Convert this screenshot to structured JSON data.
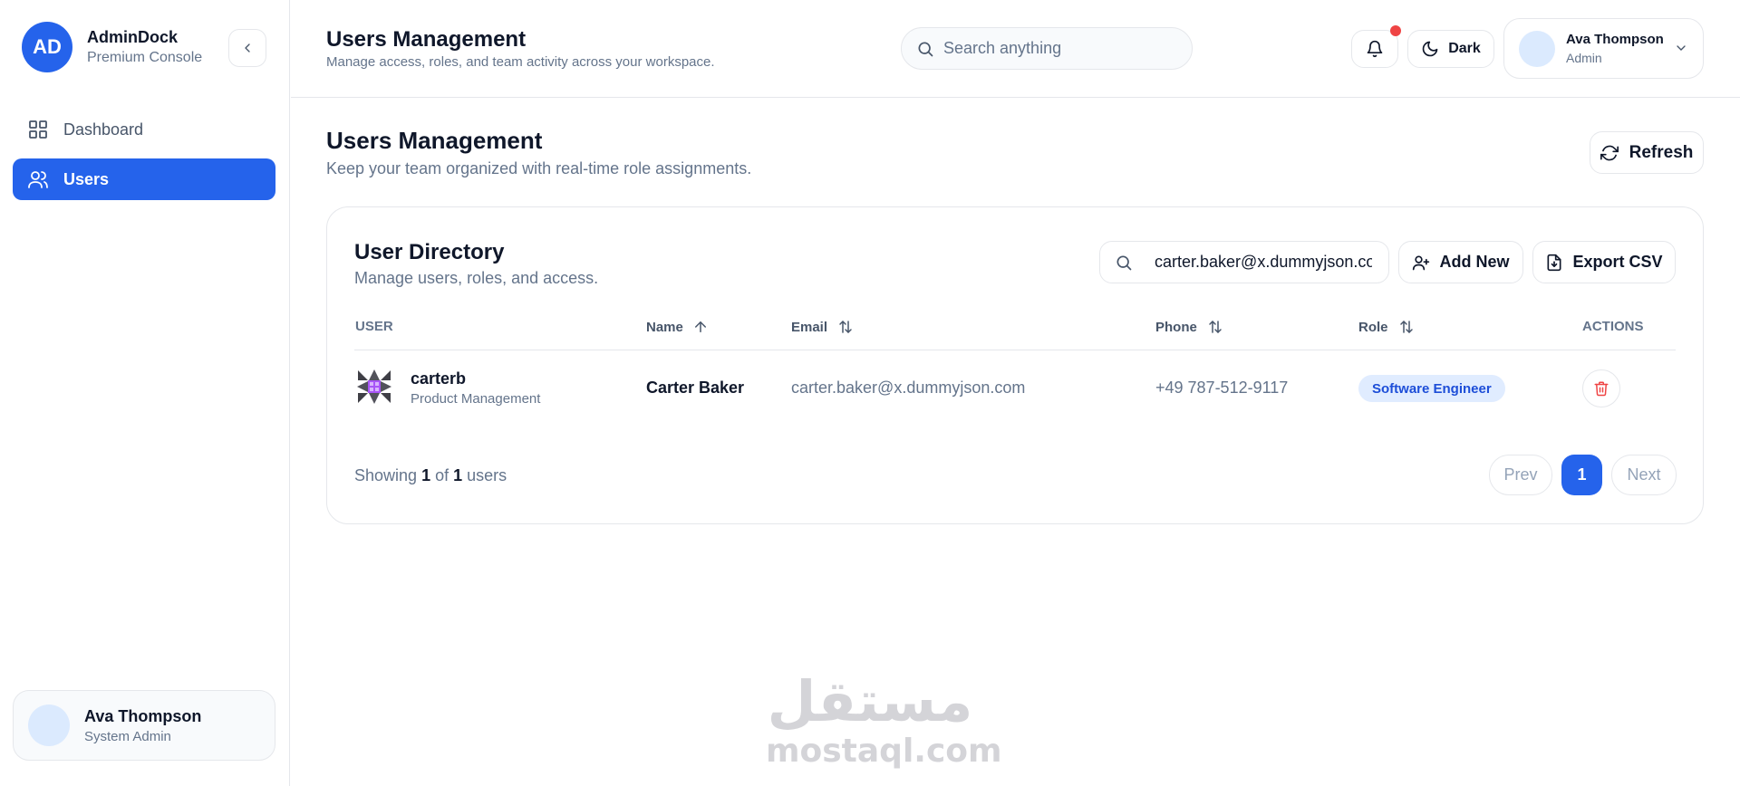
{
  "brand": {
    "logo_text": "AD",
    "name": "AdminDock",
    "subtitle": "Premium Console"
  },
  "sidebar": {
    "items": [
      {
        "label": "Dashboard",
        "icon": "dashboard-grid-icon",
        "active": false
      },
      {
        "label": "Users",
        "icon": "users-icon",
        "active": true
      }
    ],
    "profile": {
      "name": "Ava Thompson",
      "role": "System Admin"
    }
  },
  "header": {
    "title": "Users Management",
    "subtitle": "Manage access, roles, and team activity across your workspace.",
    "search_placeholder": "Search anything",
    "theme_label": "Dark",
    "user": {
      "name": "Ava Thompson",
      "role": "Admin"
    }
  },
  "page": {
    "title": "Users Management",
    "subtitle": "Keep your team organized with real-time role assignments.",
    "refresh_label": "Refresh"
  },
  "directory": {
    "title": "User Directory",
    "subtitle": "Manage users, roles, and access.",
    "search_value": "carter.baker@x.dummyjson.com",
    "add_label": "Add New",
    "export_label": "Export CSV",
    "columns": [
      "USER",
      "Name",
      "Email",
      "Phone",
      "Role",
      "ACTIONS"
    ],
    "rows": [
      {
        "username": "carterb",
        "department": "Product Management",
        "name": "Carter Baker",
        "email": "carter.baker@x.dummyjson.com",
        "phone": "+49 787-512-9117",
        "role": "Software Engineer"
      }
    ],
    "showing_prefix": "Showing",
    "showing_count": "1",
    "showing_of": "of",
    "showing_total": "1",
    "showing_suffix": "users",
    "pagination": {
      "prev": "Prev",
      "current": "1",
      "next": "Next"
    }
  },
  "watermark": {
    "arabic": "مستقل",
    "latin": "mostaql.com"
  },
  "colors": {
    "accent": "#2563eb",
    "danger": "#ef4444",
    "role_badge_bg": "#e0ecff"
  }
}
